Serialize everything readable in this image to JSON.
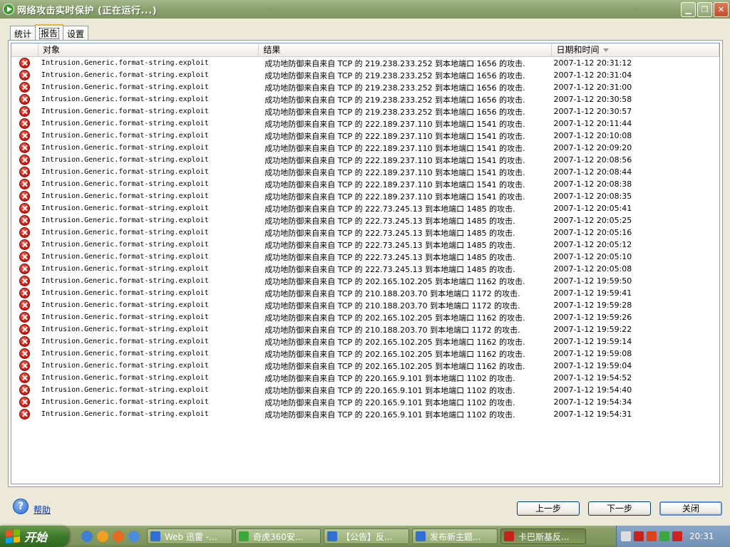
{
  "window": {
    "title": "网络攻击实时保护 (正在运行...)"
  },
  "tabs": [
    {
      "label": "统计"
    },
    {
      "label": "报告"
    },
    {
      "label": "设置"
    }
  ],
  "table": {
    "headers": [
      "对象",
      "结果",
      "日期和时间"
    ],
    "rows": [
      {
        "object": "Intrusion.Generic.format-string.exploit",
        "result": "成功地防御来自来自 TCP 的 219.238.233.252 到本地端口 1656 的攻击.",
        "time": "2007-1-12 20:31:12"
      },
      {
        "object": "Intrusion.Generic.format-string.exploit",
        "result": "成功地防御来自来自 TCP 的 219.238.233.252 到本地端口 1656 的攻击.",
        "time": "2007-1-12 20:31:04"
      },
      {
        "object": "Intrusion.Generic.format-string.exploit",
        "result": "成功地防御来自来自 TCP 的 219.238.233.252 到本地端口 1656 的攻击.",
        "time": "2007-1-12 20:31:00"
      },
      {
        "object": "Intrusion.Generic.format-string.exploit",
        "result": "成功地防御来自来自 TCP 的 219.238.233.252 到本地端口 1656 的攻击.",
        "time": "2007-1-12 20:30:58"
      },
      {
        "object": "Intrusion.Generic.format-string.exploit",
        "result": "成功地防御来自来自 TCP 的 219.238.233.252 到本地端口 1656 的攻击.",
        "time": "2007-1-12 20:30:57"
      },
      {
        "object": "Intrusion.Generic.format-string.exploit",
        "result": "成功地防御来自来自 TCP 的 222.189.237.110 到本地端口 1541 的攻击.",
        "time": "2007-1-12 20:11:44"
      },
      {
        "object": "Intrusion.Generic.format-string.exploit",
        "result": "成功地防御来自来自 TCP 的 222.189.237.110 到本地端口 1541 的攻击.",
        "time": "2007-1-12 20:10:08"
      },
      {
        "object": "Intrusion.Generic.format-string.exploit",
        "result": "成功地防御来自来自 TCP 的 222.189.237.110 到本地端口 1541 的攻击.",
        "time": "2007-1-12 20:09:20"
      },
      {
        "object": "Intrusion.Generic.format-string.exploit",
        "result": "成功地防御来自来自 TCP 的 222.189.237.110 到本地端口 1541 的攻击.",
        "time": "2007-1-12 20:08:56"
      },
      {
        "object": "Intrusion.Generic.format-string.exploit",
        "result": "成功地防御来自来自 TCP 的 222.189.237.110 到本地端口 1541 的攻击.",
        "time": "2007-1-12 20:08:44"
      },
      {
        "object": "Intrusion.Generic.format-string.exploit",
        "result": "成功地防御来自来自 TCP 的 222.189.237.110 到本地端口 1541 的攻击.",
        "time": "2007-1-12 20:08:38"
      },
      {
        "object": "Intrusion.Generic.format-string.exploit",
        "result": "成功地防御来自来自 TCP 的 222.189.237.110 到本地端口 1541 的攻击.",
        "time": "2007-1-12 20:08:35"
      },
      {
        "object": "Intrusion.Generic.format-string.exploit",
        "result": "成功地防御来自来自 TCP 的 222.73.245.13 到本地端口 1485 的攻击.",
        "time": "2007-1-12 20:05:41"
      },
      {
        "object": "Intrusion.Generic.format-string.exploit",
        "result": "成功地防御来自来自 TCP 的 222.73.245.13 到本地端口 1485 的攻击.",
        "time": "2007-1-12 20:05:25"
      },
      {
        "object": "Intrusion.Generic.format-string.exploit",
        "result": "成功地防御来自来自 TCP 的 222.73.245.13 到本地端口 1485 的攻击.",
        "time": "2007-1-12 20:05:16"
      },
      {
        "object": "Intrusion.Generic.format-string.exploit",
        "result": "成功地防御来自来自 TCP 的 222.73.245.13 到本地端口 1485 的攻击.",
        "time": "2007-1-12 20:05:12"
      },
      {
        "object": "Intrusion.Generic.format-string.exploit",
        "result": "成功地防御来自来自 TCP 的 222.73.245.13 到本地端口 1485 的攻击.",
        "time": "2007-1-12 20:05:10"
      },
      {
        "object": "Intrusion.Generic.format-string.exploit",
        "result": "成功地防御来自来自 TCP 的 222.73.245.13 到本地端口 1485 的攻击.",
        "time": "2007-1-12 20:05:08"
      },
      {
        "object": "Intrusion.Generic.format-string.exploit",
        "result": "成功地防御来自来自 TCP 的 202.165.102.205 到本地端口 1162 的攻击.",
        "time": "2007-1-12 19:59:50"
      },
      {
        "object": "Intrusion.Generic.format-string.exploit",
        "result": "成功地防御来自来自 TCP 的 210.188.203.70 到本地端口 1172 的攻击.",
        "time": "2007-1-12 19:59:41"
      },
      {
        "object": "Intrusion.Generic.format-string.exploit",
        "result": "成功地防御来自来自 TCP 的 210.188.203.70 到本地端口 1172 的攻击.",
        "time": "2007-1-12 19:59:28"
      },
      {
        "object": "Intrusion.Generic.format-string.exploit",
        "result": "成功地防御来自来自 TCP 的 202.165.102.205 到本地端口 1162 的攻击.",
        "time": "2007-1-12 19:59:26"
      },
      {
        "object": "Intrusion.Generic.format-string.exploit",
        "result": "成功地防御来自来自 TCP 的 210.188.203.70 到本地端口 1172 的攻击.",
        "time": "2007-1-12 19:59:22"
      },
      {
        "object": "Intrusion.Generic.format-string.exploit",
        "result": "成功地防御来自来自 TCP 的 202.165.102.205 到本地端口 1162 的攻击.",
        "time": "2007-1-12 19:59:14"
      },
      {
        "object": "Intrusion.Generic.format-string.exploit",
        "result": "成功地防御来自来自 TCP 的 202.165.102.205 到本地端口 1162 的攻击.",
        "time": "2007-1-12 19:59:08"
      },
      {
        "object": "Intrusion.Generic.format-string.exploit",
        "result": "成功地防御来自来自 TCP 的 202.165.102.205 到本地端口 1162 的攻击.",
        "time": "2007-1-12 19:59:04"
      },
      {
        "object": "Intrusion.Generic.format-string.exploit",
        "result": "成功地防御来自来自 TCP 的 220.165.9.101 到本地端口 1102 的攻击.",
        "time": "2007-1-12 19:54:52"
      },
      {
        "object": "Intrusion.Generic.format-string.exploit",
        "result": "成功地防御来自来自 TCP 的 220.165.9.101 到本地端口 1102 的攻击.",
        "time": "2007-1-12 19:54:40"
      },
      {
        "object": "Intrusion.Generic.format-string.exploit",
        "result": "成功地防御来自来自 TCP 的 220.165.9.101 到本地端口 1102 的攻击.",
        "time": "2007-1-12 19:54:34"
      },
      {
        "object": "Intrusion.Generic.format-string.exploit",
        "result": "成功地防御来自来自 TCP 的 220.165.9.101 到本地端口 1102 的攻击.",
        "time": "2007-1-12 19:54:31"
      }
    ]
  },
  "footer": {
    "help": "帮助",
    "prev": "上一步",
    "next": "下一步",
    "close": "关闭"
  },
  "taskbar": {
    "start": "开始",
    "tasks": [
      {
        "label": "Web 迅雷 -...",
        "color": "#2f6fd5"
      },
      {
        "label": "奇虎360安...",
        "color": "#3aa83a"
      },
      {
        "label": "【公告】反...",
        "color": "#2f6fd5"
      },
      {
        "label": "发布新主题...",
        "color": "#2f6fd5"
      },
      {
        "label": "卡巴斯基反...",
        "color": "#c8201a"
      }
    ],
    "clock": "20:31"
  },
  "colors": {
    "accent": "#e6b33a",
    "title_bar": "#8ba26e",
    "error": "#d41a10",
    "link": "#0030c8"
  }
}
